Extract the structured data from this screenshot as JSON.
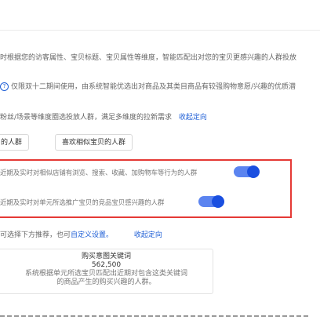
{
  "intro": {
    "line1": "时根据您的访客属性、宝贝标题、宝贝属性等维度，智能匹配出对您的宝贝更感兴趣的人群投放",
    "line2_tag": "仅限双十二期间使用，由系统智能优选出对商品及其类目商品有较强购物意愿/兴趣的优质潜",
    "line3": "粉丝/场景等维度圈选投放人群，满足多维度的拉新需求",
    "collapse_link": "收起定向"
  },
  "chips": [
    "的人群",
    "喜欢相似宝贝的人群"
  ],
  "options": [
    {
      "text": "近期及实时对相似店铺有浏览、搜索、收藏、加购物车等行为的人群",
      "enabled": true
    },
    {
      "text": "近期及实时对单元所选推广宝贝的竞品宝贝感兴趣的人群",
      "enabled": true
    }
  ],
  "recommend": {
    "prefix": "可选择下方推荐，也可",
    "custom_link": "自定义设置。",
    "collapse_link": "收起定向"
  },
  "card": {
    "title": "购买意图关键词",
    "count": "562,500",
    "desc1": "系统根据单元所选宝贝匹配出近期对包含这类关键词",
    "desc2": "的商品产生的购买兴趣的人群。"
  },
  "colors": {
    "link": "#1f5fd6",
    "highlight_border": "#e53935",
    "toggle_on": "#1a4fe0"
  }
}
